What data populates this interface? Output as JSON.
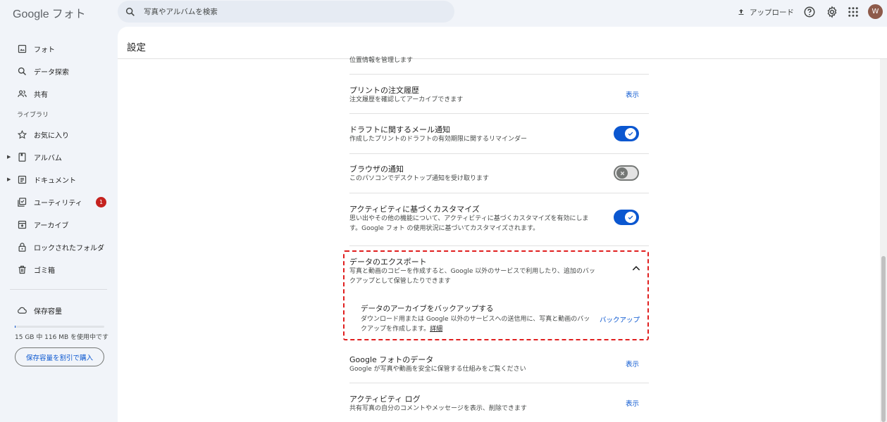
{
  "app": {
    "logo_google": "Google",
    "logo_product": "フォト"
  },
  "search": {
    "placeholder": "写真やアルバムを検索"
  },
  "header": {
    "upload_label": "アップロード",
    "avatar_initial": "W"
  },
  "sidebar": {
    "items": [
      {
        "label": "フォト"
      },
      {
        "label": "データ探索"
      },
      {
        "label": "共有"
      }
    ],
    "library_label": "ライブラリ",
    "library_items": [
      {
        "label": "お気に入り"
      },
      {
        "label": "アルバム"
      },
      {
        "label": "ドキュメント"
      },
      {
        "label": "ユーティリティ",
        "badge": "1"
      },
      {
        "label": "アーカイブ"
      },
      {
        "label": "ロックされたフォルダ"
      },
      {
        "label": "ゴミ箱"
      }
    ],
    "storage_label": "保存容量",
    "storage_usage": "15 GB 中 116 MB を使用中です",
    "storage_used_fraction": 0.0076,
    "storage_button": "保存容量を割引で購入"
  },
  "settings": {
    "title": "設定",
    "cut_text": "位置情報を管理します",
    "print_orders": {
      "title": "プリントの注文履歴",
      "desc": "注文履歴を確認してアーカイブできます",
      "link": "表示"
    },
    "draft_email": {
      "title": "ドラフトに関するメール通知",
      "desc": "作成したプリントのドラフトの有効期限に関するリマインダー",
      "enabled": true
    },
    "browser_notify": {
      "title": "ブラウザの通知",
      "desc": "このパソコンでデスクトップ通知を受け取ります",
      "enabled": false
    },
    "activity_custom": {
      "title": "アクティビティに基づくカスタマイズ",
      "desc": "思い出やその他の機能について、アクティビティに基づくカスタマイズを有効にします。Google フォト の使用状況に基づいてカスタマイズされます。",
      "enabled": true
    },
    "export": {
      "title": "データのエクスポート",
      "desc": "写真と動画のコピーを作成すると、Google 以外のサービスで利用したり、追加のバックアップとして保管したりできます",
      "sub_title": "データのアーカイブをバックアップする",
      "sub_desc": "ダウンロード用または Google 以外のサービスへの送信用に、写真と動画のバックアップを作成します。",
      "sub_more": "詳細",
      "sub_link": "バックアップ"
    },
    "photos_data": {
      "title": "Google フォトのデータ",
      "desc": "Google が写真や動画を安全に保管する仕組みをご覧ください",
      "link": "表示"
    },
    "activity_log": {
      "title": "アクティビティ ログ",
      "desc": "共有写真の自分のコメントやメッセージを表示、削除できます",
      "link": "表示"
    }
  },
  "colors": {
    "accent": "#0b57d0",
    "highlight_border": "#e01e1e",
    "badge": "#c5221f"
  }
}
